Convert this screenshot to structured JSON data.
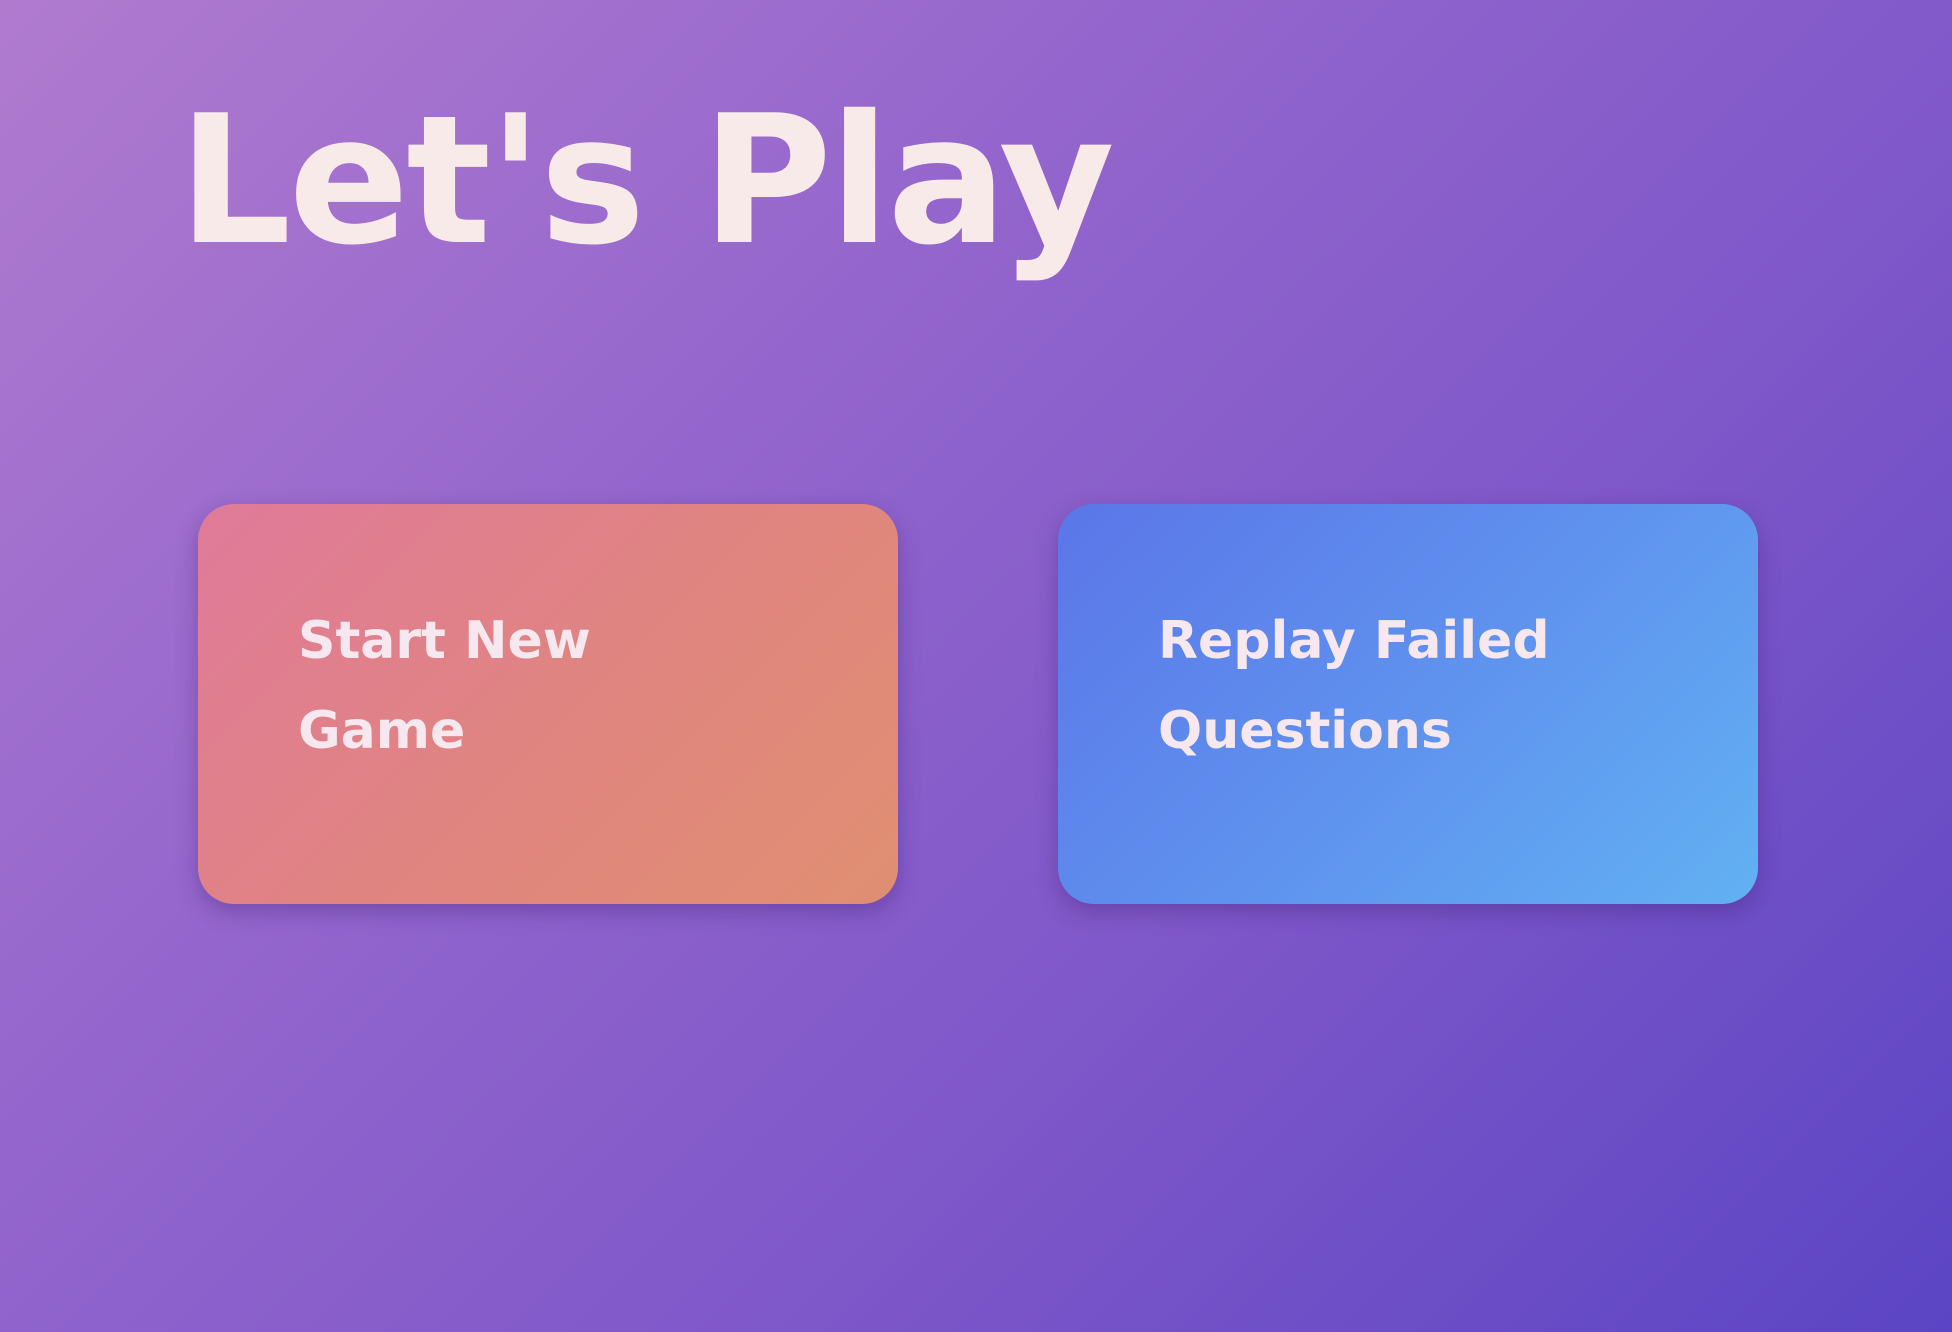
{
  "header": {
    "title": "Let's Play"
  },
  "menu": {
    "start_new_game": "Start New Game",
    "replay_failed_questions": "Replay Failed Questions"
  },
  "colors": {
    "background_start": "#b07bcf",
    "background_end": "#5b45c4",
    "start_card_start": "#e07a9a",
    "start_card_end": "#e08f72",
    "replay_card_start": "#5b76e8",
    "replay_card_end": "#62b1f3",
    "text": "#f9eaea"
  }
}
